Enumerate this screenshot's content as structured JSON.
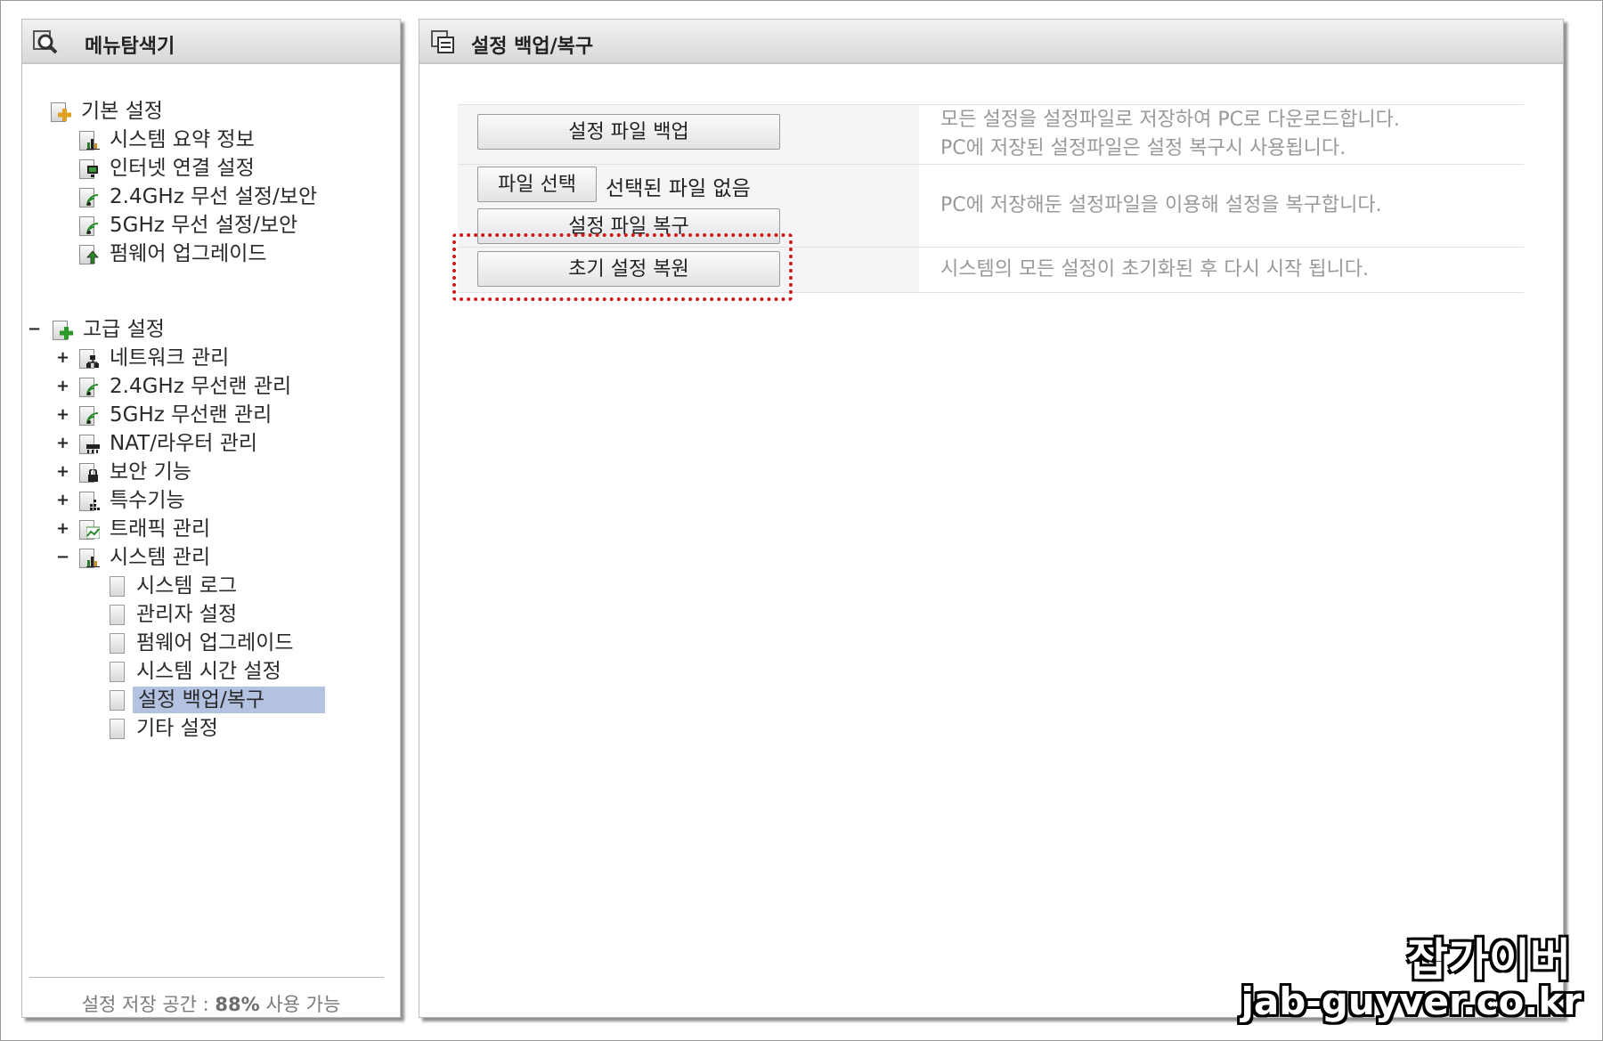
{
  "explorer": {
    "title": "메뉴탐색기",
    "basic": {
      "label": "기본 설정",
      "items": [
        "시스템 요약 정보",
        "인터넷 연결 설정",
        "2.4GHz 무선 설정/보안",
        "5GHz 무선 설정/보안",
        "펌웨어 업그레이드"
      ]
    },
    "advanced": {
      "label": "고급 설정",
      "items": [
        "네트워크 관리",
        "2.4GHz 무선랜 관리",
        "5GHz 무선랜 관리",
        "NAT/라우터 관리",
        "보안 기능",
        "특수기능",
        "트래픽 관리",
        "시스템 관리"
      ],
      "system_children": [
        "시스템 로그",
        "관리자 설정",
        "펌웨어 업그레이드",
        "시스템 시간 설정",
        "설정 백업/복구",
        "기타 설정"
      ],
      "selected": "설정 백업/복구"
    },
    "toggle_expanded": "−",
    "toggle_collapsed": "+",
    "storage": {
      "prefix": "설정 저장 공간 : ",
      "value": "88%",
      "suffix": " 사용 가능"
    }
  },
  "main": {
    "title": "설정 백업/복구",
    "backup_button": "설정 파일 백업",
    "backup_desc_1": "모든 설정을 설정파일로 저장하여 PC로 다운로드합니다.",
    "backup_desc_2": "PC에 저장된 설정파일은 설정 복구시 사용됩니다.",
    "choose_file_button": "파일 선택",
    "no_file_text": "선택된 파일 없음",
    "restore_button": "설정 파일 복구",
    "restore_desc": "PC에 저장해둔 설정파일을 이용해 설정을 복구합니다.",
    "factory_button": "초기 설정 복원",
    "factory_desc": "시스템의 모든 설정이 초기화된 후 다시 시작 됩니다."
  },
  "watermark": {
    "name": "잡가이버",
    "url": "jab-guyver.co.kr"
  },
  "colors": {
    "selection": "#b4c2e2",
    "highlight": "#cc1a1a"
  }
}
